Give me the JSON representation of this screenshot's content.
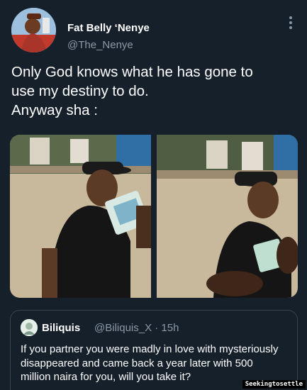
{
  "author": {
    "name": "Fat Belly ‘Nenye",
    "handle": "@The_Nenye"
  },
  "tweet": {
    "lines": [
      "Only God knows what he has gone to",
      "use my destiny to do.",
      "Anyway sha :"
    ]
  },
  "media": {
    "photos": [
      {
        "alt": "man in black cap holding naira notes"
      },
      {
        "alt": "man in black cap receiving naira notes"
      }
    ]
  },
  "quoted_tweet": {
    "name": "Biliquis",
    "handle_time": "@Biliquis_X · 15h",
    "lines": [
      "If you partner you were madly in love with mysteriously",
      "disappeared and came back a year later with 500",
      "million naira for you, will you take it?"
    ]
  },
  "watermark": "Seekingtosettle",
  "icons": {
    "more": "more-options-icon"
  },
  "colors": {
    "background": "#15202b",
    "secondary_text": "#8b98a5",
    "border": "#38444d"
  }
}
